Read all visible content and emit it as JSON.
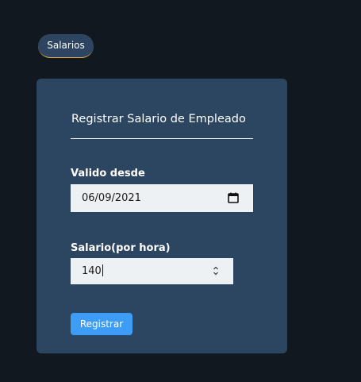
{
  "nav": {
    "salarios_label": "Salarios"
  },
  "form": {
    "title": "Registrar Salario de Empleado",
    "valido_desde_label": "Valido desde",
    "valido_desde_value": "06/09/2021",
    "salario_label": "Salario(por hora)",
    "salario_value": "140",
    "submit_label": "Registrar"
  },
  "icons": {
    "date_picker": "calendar-icon",
    "number_stepper": "spinner-arrows-icon"
  },
  "colors": {
    "page_background": "#111820",
    "card_background": "#2c4560",
    "pill_accent": "#d9a93a",
    "primary_button": "#3d9cf5",
    "input_background": "#eef1f4"
  }
}
